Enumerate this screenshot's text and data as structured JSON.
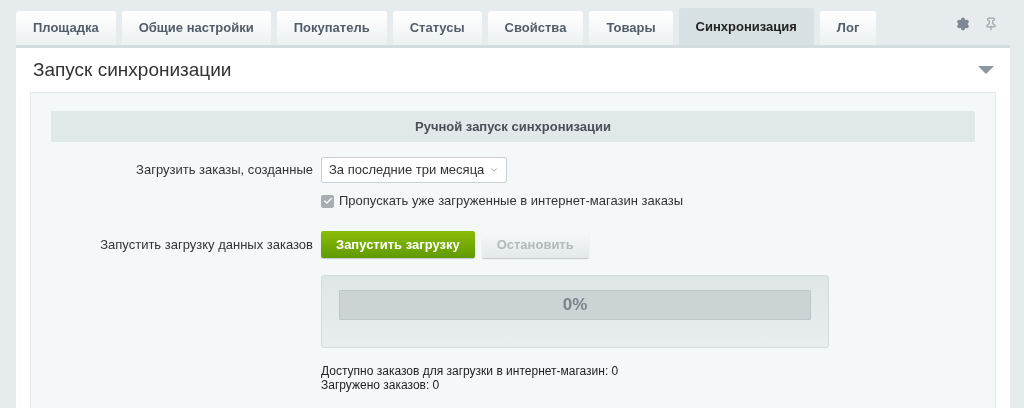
{
  "tabs": [
    {
      "label": "Площадка",
      "selected": false
    },
    {
      "label": "Общие настройки",
      "selected": false
    },
    {
      "label": "Покупатель",
      "selected": false
    },
    {
      "label": "Статусы",
      "selected": false
    },
    {
      "label": "Свойства",
      "selected": false
    },
    {
      "label": "Товары",
      "selected": false
    },
    {
      "label": "Синхронизация",
      "selected": true
    },
    {
      "label": "Лог",
      "selected": false
    }
  ],
  "section": {
    "title": "Запуск синхронизации",
    "expanded": true
  },
  "form": {
    "heading": "Ручной запуск синхронизации",
    "period": {
      "label": "Загрузить заказы, созданные",
      "value": "За последние три месяца"
    },
    "skip": {
      "label": "Пропускать уже загруженные в интернет-магазин заказы",
      "checked": true
    },
    "run": {
      "label": "Запустить загрузку данных заказов",
      "start": {
        "label": "Запустить загрузку",
        "disabled": false
      },
      "stop": {
        "label": "Остановить",
        "disabled": true
      }
    },
    "progress": {
      "level": 0,
      "reading": "0%"
    },
    "stats": [
      "Доступно заказов для загрузки в интернет-магазин: 0",
      "Загружено заказов: 0"
    ]
  }
}
